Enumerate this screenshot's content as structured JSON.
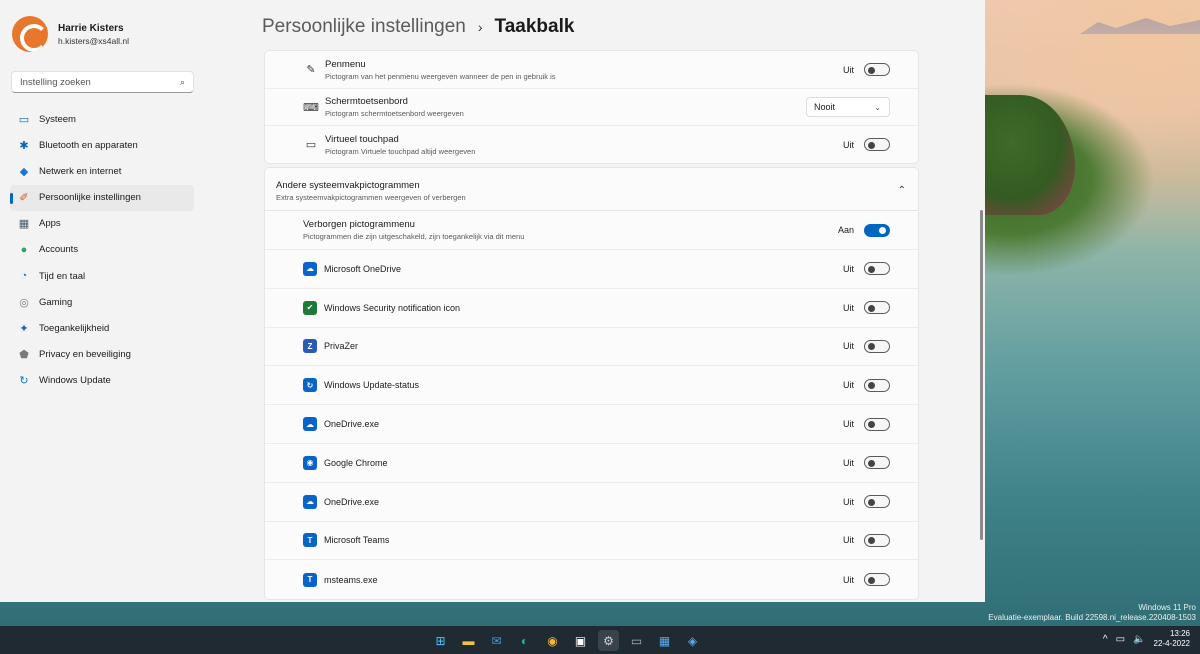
{
  "profile": {
    "name": "Harrie Kisters",
    "email": "h.kisters@xs4all.nl"
  },
  "search": {
    "placeholder": "Instelling zoeken"
  },
  "nav": [
    {
      "label": "Systeem",
      "icon": "monitor-icon",
      "color": "#0067c0"
    },
    {
      "label": "Bluetooth en apparaten",
      "icon": "bluetooth-icon",
      "color": "#0067c0"
    },
    {
      "label": "Netwerk en internet",
      "icon": "wifi-icon",
      "color": "#1a73d6"
    },
    {
      "label": "Persoonlijke instellingen",
      "icon": "brush-icon",
      "color": "#c45a1b"
    },
    {
      "label": "Apps",
      "icon": "apps-icon",
      "color": "#4a5c6a"
    },
    {
      "label": "Accounts",
      "icon": "person-icon",
      "color": "#2fa26a"
    },
    {
      "label": "Tijd en taal",
      "icon": "globe-clock-icon",
      "color": "#2a87c8"
    },
    {
      "label": "Gaming",
      "icon": "gamepad-icon",
      "color": "#7a7a7a"
    },
    {
      "label": "Toegankelijkheid",
      "icon": "accessibility-icon",
      "color": "#1a5fb4"
    },
    {
      "label": "Privacy en beveiliging",
      "icon": "shield-icon",
      "color": "#7a7a7a"
    },
    {
      "label": "Windows Update",
      "icon": "update-icon",
      "color": "#0a78d4"
    }
  ],
  "breadcrumb": {
    "parent": "Persoonlijke instellingen",
    "separator": "›",
    "current": "Taakbalk"
  },
  "pen_rows": [
    {
      "title": "Penmenu",
      "sub": "Pictogram van het penmenu weergeven wanneer de pen in gebruik is",
      "state": "Uit",
      "icon": "pen-icon"
    },
    {
      "title": "Schermtoetsenbord",
      "sub": "Pictogram schermtoetsenbord weergeven",
      "dropdown": "Nooit",
      "icon": "keyboard-icon"
    },
    {
      "title": "Virtueel touchpad",
      "sub": "Pictogram Virtuele touchpad altijd weergeven",
      "state": "Uit",
      "icon": "touchpad-icon"
    }
  ],
  "section": {
    "title": "Andere systeemvakpictogrammen",
    "sub": "Extra systeemvakpictogrammen weergeven of verbergen"
  },
  "hidden_menu": {
    "title": "Verborgen pictogrammenu",
    "sub": "Pictogrammen die zijn uitgeschakeld, zijn toegankelijk via dit menu",
    "state": "Aan"
  },
  "apps": [
    {
      "name": "Microsoft OneDrive",
      "state": "Uit",
      "color": "#0a64c8",
      "glyph": "☁"
    },
    {
      "name": "Windows Security notification icon",
      "state": "Uit",
      "color": "#1f7a3a",
      "glyph": "✔"
    },
    {
      "name": "PrivaZer",
      "state": "Uit",
      "color": "#2a5bb5",
      "glyph": "Z"
    },
    {
      "name": "Windows Update-status",
      "state": "Uit",
      "color": "#0a64c8",
      "glyph": "↻"
    },
    {
      "name": "OneDrive.exe",
      "state": "Uit",
      "color": "#0a64c8",
      "glyph": "☁"
    },
    {
      "name": "Google Chrome",
      "state": "Uit",
      "color": "#0a64c8",
      "glyph": "◉"
    },
    {
      "name": "OneDrive.exe",
      "state": "Uit",
      "color": "#0a64c8",
      "glyph": "☁"
    },
    {
      "name": "Microsoft Teams",
      "state": "Uit",
      "color": "#0a64c8",
      "glyph": "T"
    },
    {
      "name": "msteams.exe",
      "state": "Uit",
      "color": "#0a64c8",
      "glyph": "T"
    }
  ],
  "watermark": {
    "line1": "Windows 11 Pro",
    "line2": "Evaluatie-exemplaar. Build 22598.ni_release.220408-1503"
  },
  "taskbar": {
    "apps": [
      {
        "icon": "start-icon",
        "glyph": "⊞",
        "color": "#4cc2ff"
      },
      {
        "icon": "file-explorer-icon",
        "glyph": "▬",
        "color": "#f3c23c"
      },
      {
        "icon": "mail-icon",
        "glyph": "✉",
        "color": "#3aa0f0"
      },
      {
        "icon": "edge-icon",
        "glyph": "◐",
        "color": "#2bb3a0"
      },
      {
        "icon": "chrome-icon",
        "glyph": "◉",
        "color": "#f2b632"
      },
      {
        "icon": "store-icon",
        "glyph": "▣",
        "color": "#ffffff"
      },
      {
        "icon": "settings-icon",
        "glyph": "⚙",
        "color": "#d0d0d0"
      },
      {
        "icon": "terminal-icon",
        "glyph": "▭",
        "color": "#b0b0b0"
      },
      {
        "icon": "remote-desktop-icon",
        "glyph": "▦",
        "color": "#5aa8f0"
      },
      {
        "icon": "app-icon",
        "glyph": "◈",
        "color": "#5aa8f0"
      }
    ],
    "time": "13:26",
    "date": "22-4-2022"
  }
}
